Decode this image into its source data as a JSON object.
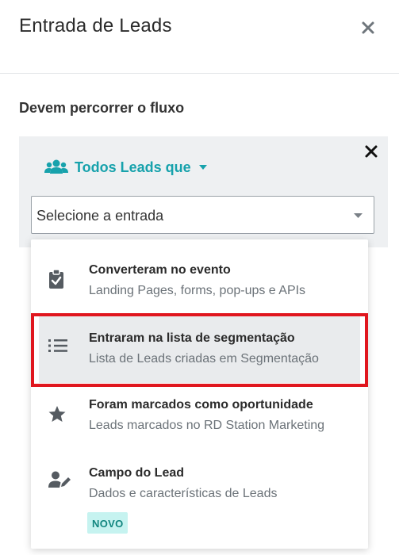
{
  "header": {
    "title": "Entrada de Leads"
  },
  "section": {
    "label": "Devem percorrer o fluxo"
  },
  "flow": {
    "filter_label": "Todos Leads que",
    "select_placeholder": "Selecione a entrada"
  },
  "options": [
    {
      "title": "Converteram no evento",
      "subtitle": "Landing Pages, forms, pop-ups e APIs",
      "icon": "clipboard-check-icon"
    },
    {
      "title": "Entraram na lista de segmentação",
      "subtitle": "Lista de Leads criadas em Segmentação",
      "icon": "list-icon",
      "highlighted": true
    },
    {
      "title": "Foram marcados como oportunidade",
      "subtitle": "Leads marcados no RD Station Marketing",
      "icon": "star-icon"
    },
    {
      "title": "Campo do Lead",
      "subtitle": "Dados e características de Leads",
      "icon": "user-edit-icon",
      "badge": "NOVO"
    }
  ],
  "colors": {
    "accent": "#17a2ac",
    "highlight_border": "#e0161e",
    "badge_bg": "#c6f3f0",
    "badge_text": "#12867f"
  }
}
